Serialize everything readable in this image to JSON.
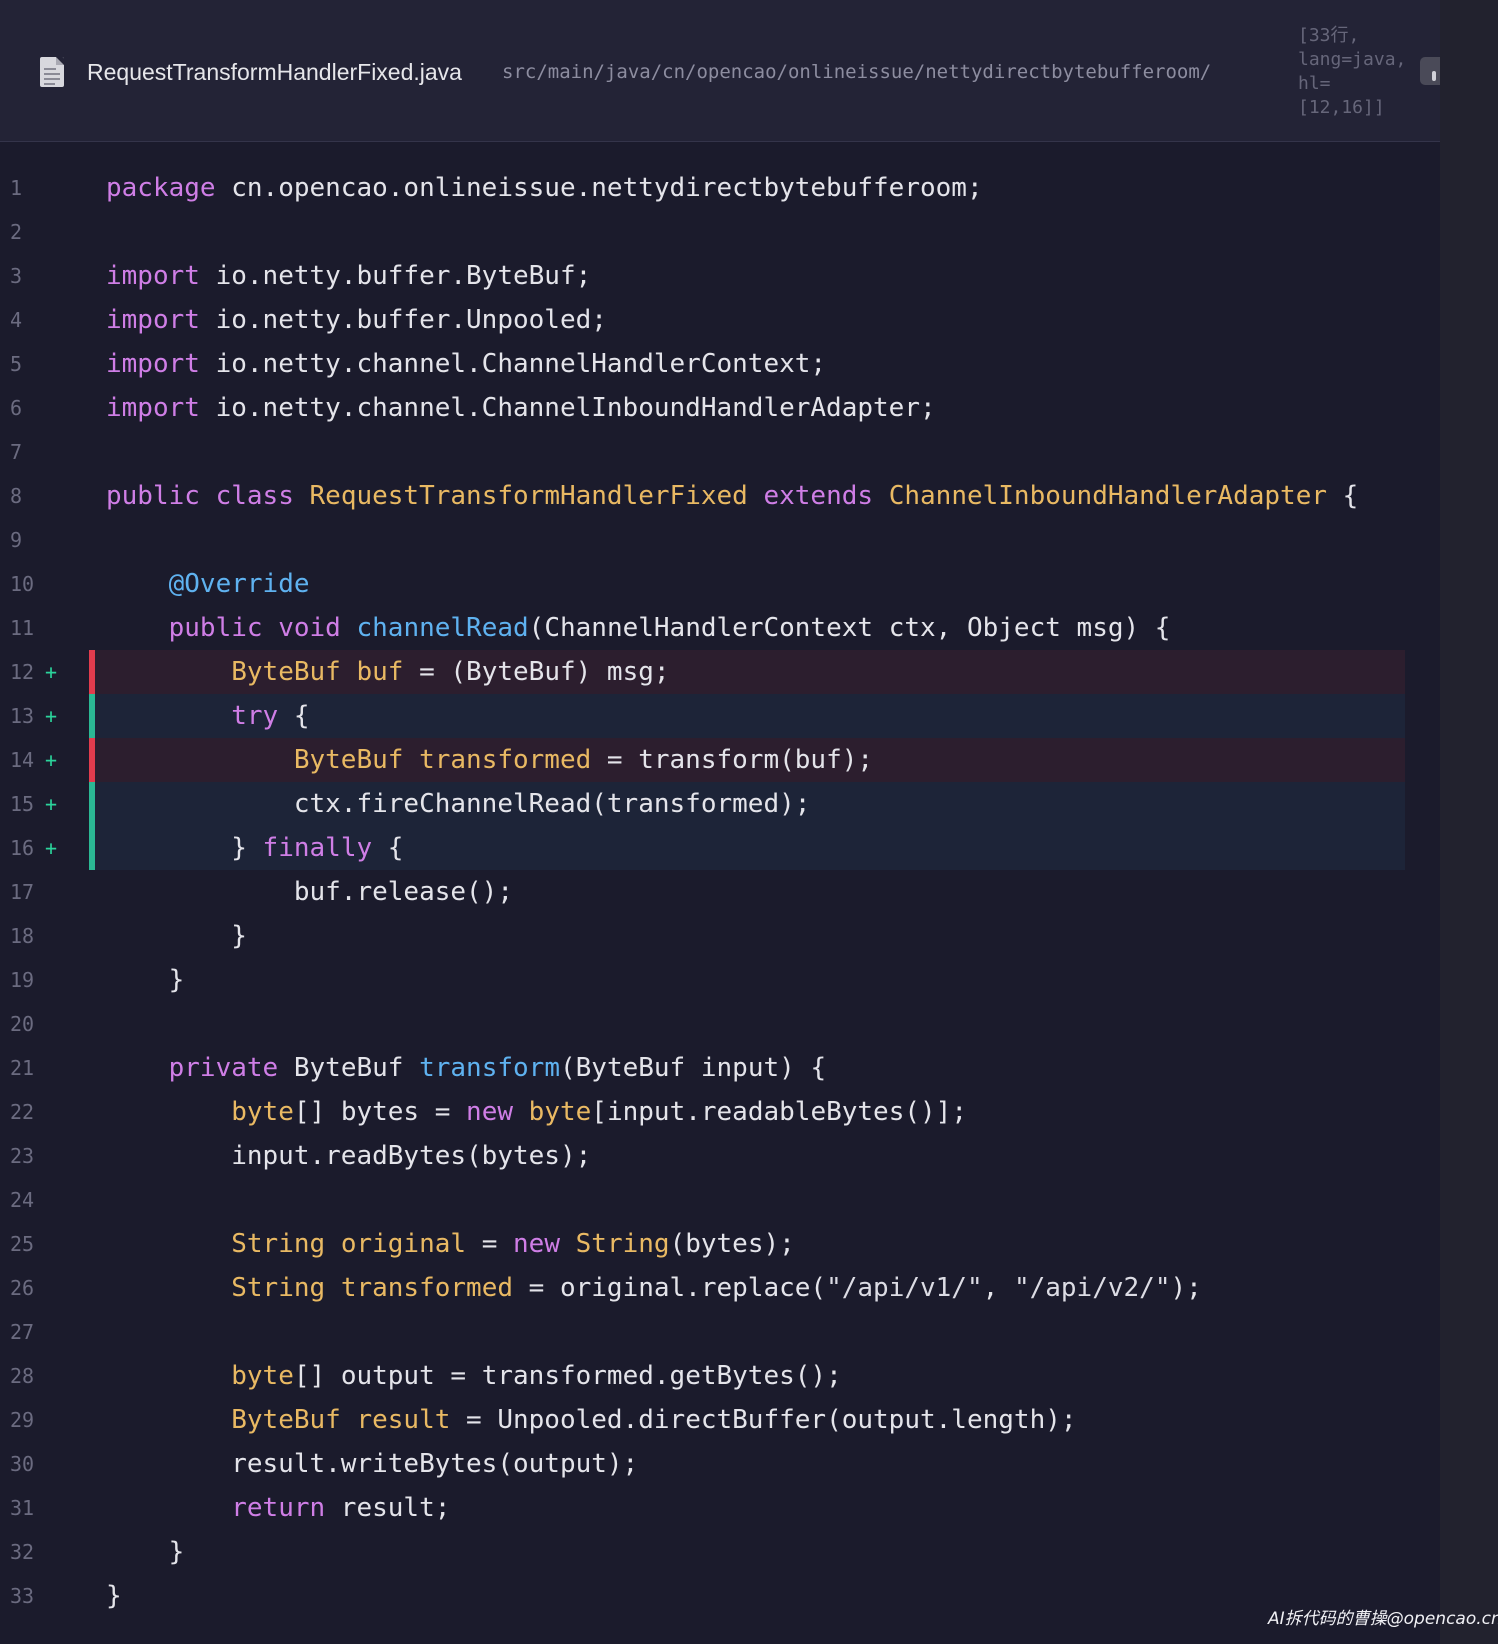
{
  "header": {
    "file_name": "RequestTransformHandlerFixed.java",
    "file_path": "src/main/java/cn/opencao/onlineissue/nettydirectbytebufferoom/",
    "file_icon": "file-document-icon",
    "meta_lines": [
      "[33行,",
      "lang=java,",
      "hl=",
      "[12,16]]"
    ]
  },
  "colors": {
    "background": "#1b1b2c",
    "header_background": "#232336",
    "keyword": "#cf7ee6",
    "type": "#e9b963",
    "function": "#5fb2f0",
    "highlight_red": "#e23c4d",
    "highlight_green": "#2bb894",
    "added_marker": "#2bd39b"
  },
  "code": {
    "highlight_range": [
      12,
      16
    ],
    "lines": [
      {
        "n": "1",
        "mark": "",
        "hl": "",
        "tokens": [
          [
            "kw",
            "package"
          ],
          [
            "pl",
            " cn.opencao.onlineissue.nettydirectbytebufferoom;"
          ]
        ]
      },
      {
        "n": "2",
        "mark": "",
        "hl": "",
        "tokens": []
      },
      {
        "n": "3",
        "mark": "",
        "hl": "",
        "tokens": [
          [
            "kw",
            "import"
          ],
          [
            "pl",
            " io.netty.buffer.ByteBuf;"
          ]
        ]
      },
      {
        "n": "4",
        "mark": "",
        "hl": "",
        "tokens": [
          [
            "kw",
            "import"
          ],
          [
            "pl",
            " io.netty.buffer.Unpooled;"
          ]
        ]
      },
      {
        "n": "5",
        "mark": "",
        "hl": "",
        "tokens": [
          [
            "kw",
            "import"
          ],
          [
            "pl",
            " io.netty.channel.ChannelHandlerContext;"
          ]
        ]
      },
      {
        "n": "6",
        "mark": "",
        "hl": "",
        "tokens": [
          [
            "kw",
            "import"
          ],
          [
            "pl",
            " io.netty.channel.ChannelInboundHandlerAdapter;"
          ]
        ]
      },
      {
        "n": "7",
        "mark": "",
        "hl": "",
        "tokens": []
      },
      {
        "n": "8",
        "mark": "",
        "hl": "",
        "tokens": [
          [
            "kw",
            "public"
          ],
          [
            "pl",
            " "
          ],
          [
            "kw",
            "class"
          ],
          [
            "pl",
            " "
          ],
          [
            "ty",
            "RequestTransformHandlerFixed"
          ],
          [
            "pl",
            " "
          ],
          [
            "kw",
            "extends"
          ],
          [
            "pl",
            " "
          ],
          [
            "ty",
            "ChannelInboundHandlerAdapter"
          ],
          [
            "pl",
            " {"
          ]
        ]
      },
      {
        "n": "9",
        "mark": "",
        "hl": "",
        "tokens": []
      },
      {
        "n": "10",
        "mark": "",
        "hl": "",
        "tokens": [
          [
            "pl",
            "    "
          ],
          [
            "an",
            "@Override"
          ]
        ]
      },
      {
        "n": "11",
        "mark": "",
        "hl": "",
        "tokens": [
          [
            "pl",
            "    "
          ],
          [
            "kw",
            "public"
          ],
          [
            "pl",
            " "
          ],
          [
            "kw",
            "void"
          ],
          [
            "pl",
            " "
          ],
          [
            "fn",
            "channelRead"
          ],
          [
            "pl",
            "(ChannelHandlerContext ctx, Object msg) {"
          ]
        ]
      },
      {
        "n": "12",
        "mark": "+",
        "hl": "red",
        "tokens": [
          [
            "pl",
            "        "
          ],
          [
            "ty",
            "ByteBuf"
          ],
          [
            "pl",
            " "
          ],
          [
            "ty",
            "buf"
          ],
          [
            "pl",
            " = (ByteBuf) msg;"
          ]
        ]
      },
      {
        "n": "13",
        "mark": "+",
        "hl": "green",
        "tokens": [
          [
            "pl",
            "        "
          ],
          [
            "kw",
            "try"
          ],
          [
            "pl",
            " {"
          ]
        ]
      },
      {
        "n": "14",
        "mark": "+",
        "hl": "red",
        "tokens": [
          [
            "pl",
            "            "
          ],
          [
            "ty",
            "ByteBuf"
          ],
          [
            "pl",
            " "
          ],
          [
            "ty",
            "transformed"
          ],
          [
            "pl",
            " = transform(buf);"
          ]
        ]
      },
      {
        "n": "15",
        "mark": "+",
        "hl": "green",
        "tokens": [
          [
            "pl",
            "            ctx.fireChannelRead(transformed);"
          ]
        ]
      },
      {
        "n": "16",
        "mark": "+",
        "hl": "green",
        "tokens": [
          [
            "pl",
            "        } "
          ],
          [
            "kw",
            "finally"
          ],
          [
            "pl",
            " {"
          ]
        ]
      },
      {
        "n": "17",
        "mark": "",
        "hl": "",
        "tokens": [
          [
            "pl",
            "            buf.release();"
          ]
        ]
      },
      {
        "n": "18",
        "mark": "",
        "hl": "",
        "tokens": [
          [
            "pl",
            "        }"
          ]
        ]
      },
      {
        "n": "19",
        "mark": "",
        "hl": "",
        "tokens": [
          [
            "pl",
            "    }"
          ]
        ]
      },
      {
        "n": "20",
        "mark": "",
        "hl": "",
        "tokens": []
      },
      {
        "n": "21",
        "mark": "",
        "hl": "",
        "tokens": [
          [
            "pl",
            "    "
          ],
          [
            "kw",
            "private"
          ],
          [
            "pl",
            " ByteBuf "
          ],
          [
            "fn",
            "transform"
          ],
          [
            "pl",
            "(ByteBuf input) {"
          ]
        ]
      },
      {
        "n": "22",
        "mark": "",
        "hl": "",
        "tokens": [
          [
            "pl",
            "        "
          ],
          [
            "ty",
            "byte"
          ],
          [
            "pl",
            "[] bytes = "
          ],
          [
            "kw",
            "new"
          ],
          [
            "pl",
            " "
          ],
          [
            "ty",
            "byte"
          ],
          [
            "pl",
            "[input.readableBytes()];"
          ]
        ]
      },
      {
        "n": "23",
        "mark": "",
        "hl": "",
        "tokens": [
          [
            "pl",
            "        input.readBytes(bytes);"
          ]
        ]
      },
      {
        "n": "24",
        "mark": "",
        "hl": "",
        "tokens": []
      },
      {
        "n": "25",
        "mark": "",
        "hl": "",
        "tokens": [
          [
            "pl",
            "        "
          ],
          [
            "ty",
            "String"
          ],
          [
            "pl",
            " "
          ],
          [
            "ty",
            "original"
          ],
          [
            "pl",
            " = "
          ],
          [
            "kw",
            "new"
          ],
          [
            "pl",
            " "
          ],
          [
            "ty",
            "String"
          ],
          [
            "pl",
            "(bytes);"
          ]
        ]
      },
      {
        "n": "26",
        "mark": "",
        "hl": "",
        "tokens": [
          [
            "pl",
            "        "
          ],
          [
            "ty",
            "String"
          ],
          [
            "pl",
            " "
          ],
          [
            "ty",
            "transformed"
          ],
          [
            "pl",
            " = original.replace("
          ],
          [
            "st",
            "\"/api/v1/\""
          ],
          [
            "pl",
            ", "
          ],
          [
            "st",
            "\"/api/v2/\""
          ],
          [
            "pl",
            ");"
          ]
        ]
      },
      {
        "n": "27",
        "mark": "",
        "hl": "",
        "tokens": []
      },
      {
        "n": "28",
        "mark": "",
        "hl": "",
        "tokens": [
          [
            "pl",
            "        "
          ],
          [
            "ty",
            "byte"
          ],
          [
            "pl",
            "[] output = transformed.getBytes();"
          ]
        ]
      },
      {
        "n": "29",
        "mark": "",
        "hl": "",
        "tokens": [
          [
            "pl",
            "        "
          ],
          [
            "ty",
            "ByteBuf"
          ],
          [
            "pl",
            " "
          ],
          [
            "ty",
            "result"
          ],
          [
            "pl",
            " = Unpooled.directBuffer(output.length);"
          ]
        ]
      },
      {
        "n": "30",
        "mark": "",
        "hl": "",
        "tokens": [
          [
            "pl",
            "        result.writeBytes(output);"
          ]
        ]
      },
      {
        "n": "31",
        "mark": "",
        "hl": "",
        "tokens": [
          [
            "pl",
            "        "
          ],
          [
            "kw",
            "return"
          ],
          [
            "pl",
            " result;"
          ]
        ]
      },
      {
        "n": "32",
        "mark": "",
        "hl": "",
        "tokens": [
          [
            "pl",
            "    }"
          ]
        ]
      },
      {
        "n": "33",
        "mark": "",
        "hl": "",
        "tokens": [
          [
            "pl",
            "}"
          ]
        ]
      }
    ]
  },
  "watermark": "AI拆代码的曹操@opencao.cn"
}
